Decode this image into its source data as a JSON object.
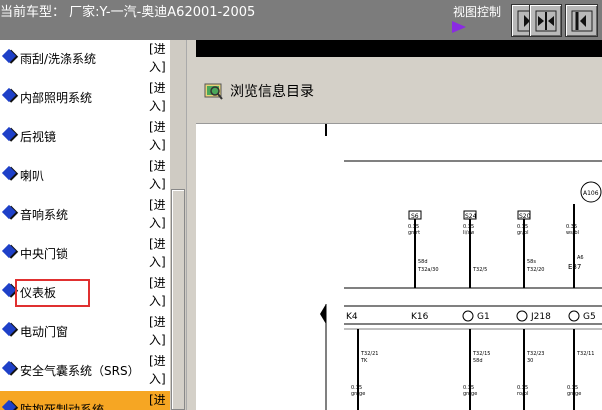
{
  "header": {
    "car_model": "当前车型： 厂家:Y-一汽-奥迪A62001-2005",
    "view_control_label": "视图控制",
    "buttons": [
      "expand-right-icon",
      "split-view-icon"
    ]
  },
  "sidebar": {
    "enter_line1": "[进",
    "enter_line2": "入]",
    "items": [
      {
        "label": "雨刮/洗涤系统"
      },
      {
        "label": "内部照明系统"
      },
      {
        "label": "后视镜"
      },
      {
        "label": "喇叭"
      },
      {
        "label": "音响系统"
      },
      {
        "label": "中央门锁"
      },
      {
        "label": "仪表板"
      },
      {
        "label": "电动门窗"
      },
      {
        "label": "安全气囊系统（SRS）"
      },
      {
        "label": "防抱死制动系统"
      }
    ],
    "active_item": "防抱死制动系统",
    "highlighted_item": "仪表板"
  },
  "content": {
    "title": "浏览信息目录"
  },
  "diagram": {
    "top_labels": [
      "A106"
    ],
    "fuses": [
      {
        "num": "S6",
        "wire": "0.35",
        "color": "gn/rt",
        "conn": "58d",
        "pin": "T32a/30"
      },
      {
        "num": "S24",
        "wire": "0.35",
        "color": "li/sw",
        "conn": "",
        "pin": "T32/5"
      },
      {
        "num": "S20",
        "wire": "0.35",
        "color": "gr/bl",
        "conn": "58s",
        "pin": "T32/20"
      },
      {
        "num": "",
        "wire": "0.35",
        "color": "ws/bl",
        "conn": "A6",
        "pin": "E87"
      }
    ],
    "components": [
      "K4",
      "K16",
      "G1",
      "J218",
      "G5"
    ],
    "bottom": [
      {
        "pin": "T32/21",
        "extra": "TK",
        "wire": "0.35",
        "color": "gn/ge"
      },
      {
        "pin": "T32/15",
        "extra": "58d",
        "wire": "0.35",
        "color": "gn/ge"
      },
      {
        "pin": "T32/23",
        "extra": "30",
        "wire": "0.35",
        "color": "ro/bl"
      },
      {
        "pin": "T32/11",
        "extra": "",
        "wire": "0.35",
        "color": "gn/ge"
      }
    ]
  }
}
